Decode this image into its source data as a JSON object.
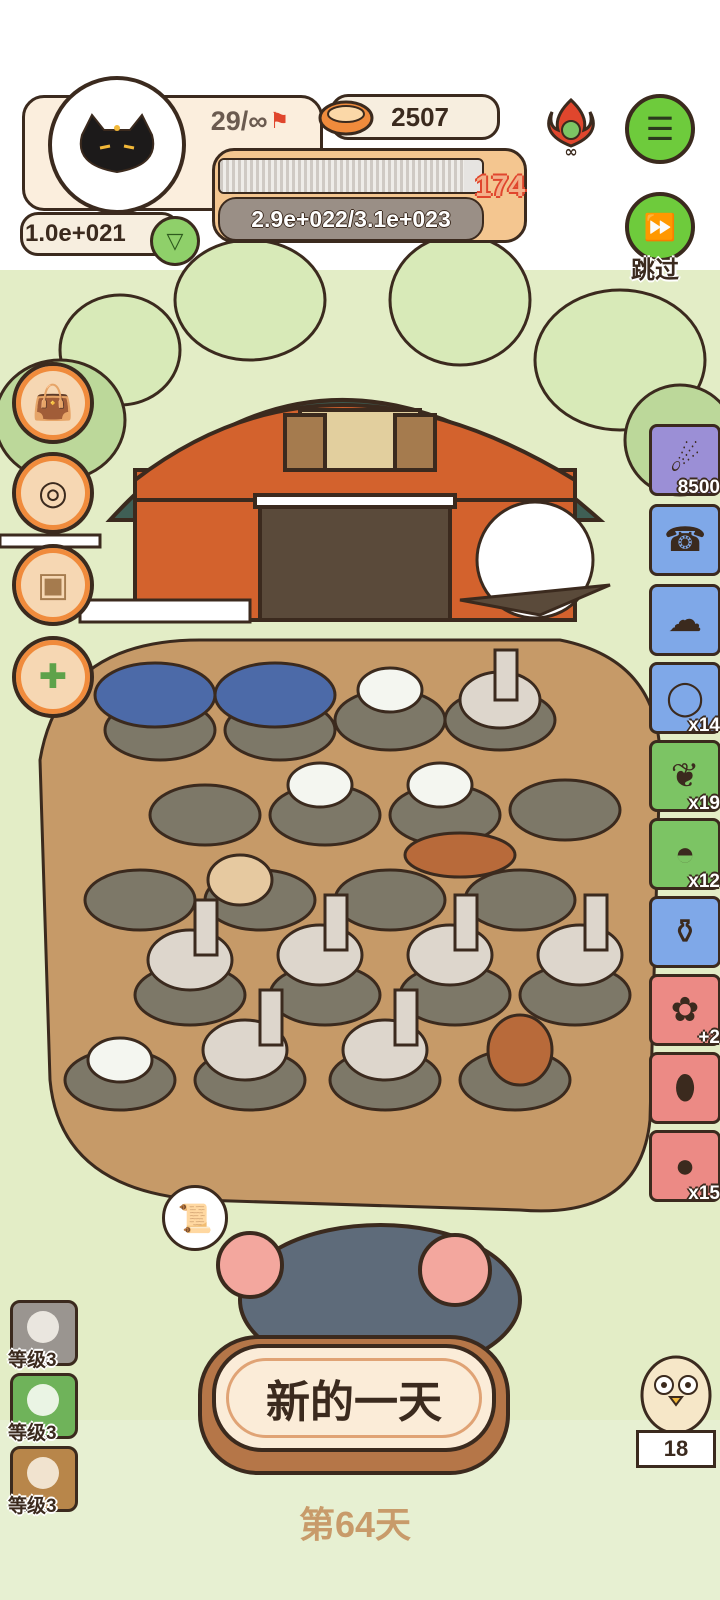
{
  "hud": {
    "capacity": "29/∞",
    "coins": "2507",
    "progress_fraction": 0.93,
    "progress_text": "2.9e+022/3.1e+023",
    "level_number": "174",
    "income": "1.0e+021"
  },
  "skip": {
    "label": "跳过"
  },
  "right_items": [
    {
      "name": "meteor-item",
      "count": "8500",
      "bg": "#9b8fd6"
    },
    {
      "name": "phone-item",
      "count": "",
      "bg": "#7fa8e8"
    },
    {
      "name": "sheep-item",
      "count": "",
      "bg": "#7fa8e8"
    },
    {
      "name": "donut-item",
      "count": "x14",
      "bg": "#7fa8e8"
    },
    {
      "name": "leaf-item",
      "count": "x19",
      "bg": "#7cc464"
    },
    {
      "name": "helmet-item",
      "count": "x12",
      "bg": "#7cc464"
    },
    {
      "name": "jar-item",
      "count": "",
      "bg": "#7fa8e8"
    },
    {
      "name": "paw-boost-item",
      "count": "+2",
      "bg": "#ec8a85"
    },
    {
      "name": "dino-egg-item",
      "count": "",
      "bg": "#ec8a85"
    },
    {
      "name": "bomb-item",
      "count": "x15",
      "bg": "#ec8a85"
    }
  ],
  "left_level_cards": [
    {
      "label": "等级3"
    },
    {
      "label": "等级3"
    },
    {
      "label": "等级3"
    }
  ],
  "new_day_button": "新的一天",
  "day_counter": "第64天",
  "owl_count": "18",
  "colors": {
    "outline": "#3b2a1e",
    "accent": "#f08b3c",
    "green_btn": "#6ecb3c"
  }
}
